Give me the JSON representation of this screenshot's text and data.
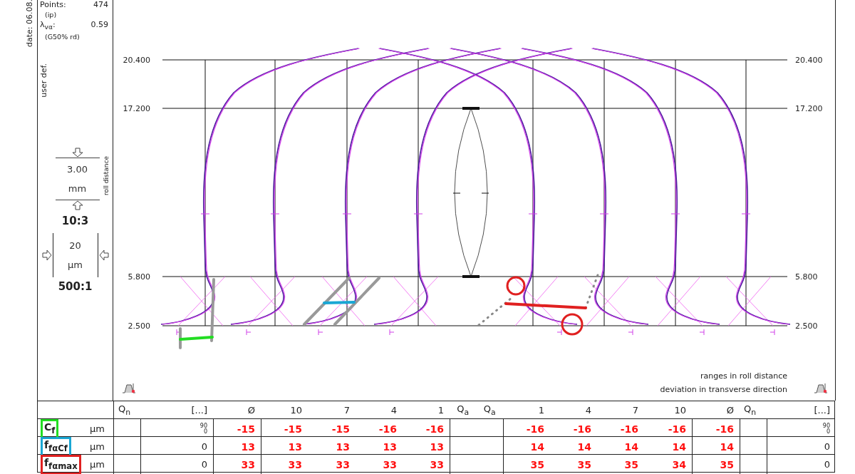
{
  "date_label": "date: 06.08.",
  "info": {
    "points_label": "Points:",
    "points_value": "474",
    "points_note": "(ip)",
    "lambda_label": "λ$_{vα}$:",
    "lambda_value": "0.59",
    "lambda_note": "(G50% rd)",
    "mode": "user def."
  },
  "scale": {
    "roll_value": "3.00",
    "roll_unit": "mm",
    "roll_caption": "roll distance",
    "roll_ratio": "10:3",
    "dev_value": "20",
    "dev_unit": "µm",
    "dev_ratio": "500:1"
  },
  "chart": {
    "left_ticks": [
      "20.400",
      "17.200",
      "5.800",
      "2.500"
    ],
    "right_ticks": [
      "20.400",
      "17.200",
      "5.800",
      "2.500"
    ],
    "legend": [
      "ranges in roll distance",
      "deviation in transverse direction"
    ]
  },
  "table": {
    "header": [
      "Q$_{n}$",
      "[...]",
      "Ø",
      "10",
      "7",
      "4",
      "1",
      "Q$_{a}$",
      "Q$_{a}$",
      "1",
      "4",
      "7",
      "10",
      "Ø",
      "Q$_{n}$",
      "[...]"
    ],
    "rows": [
      {
        "label": "C$_{f}$",
        "unit": "µm",
        "color": "#22dd22",
        "left_range": [
          "90",
          "0"
        ],
        "values": [
          "-15",
          "-15",
          "-15",
          "-16",
          "-16",
          "-16",
          "-16",
          "-16",
          "-16",
          "-16"
        ],
        "right_range": [
          "90",
          "0"
        ]
      },
      {
        "label": "f$_{fαCf}$",
        "unit": "µm",
        "color": "#1aa7d4",
        "left_range": [
          "0"
        ],
        "values": [
          "13",
          "13",
          "13",
          "13",
          "13",
          "14",
          "14",
          "14",
          "14",
          "14"
        ],
        "right_range": [
          "0"
        ]
      },
      {
        "label": "f$_{fαmax}$",
        "unit": "µm",
        "color": "#e02020",
        "left_range": [
          "0"
        ],
        "values": [
          "33",
          "33",
          "33",
          "33",
          "33",
          "35",
          "35",
          "35",
          "34",
          "35"
        ],
        "right_range": [
          "0"
        ]
      }
    ]
  }
}
